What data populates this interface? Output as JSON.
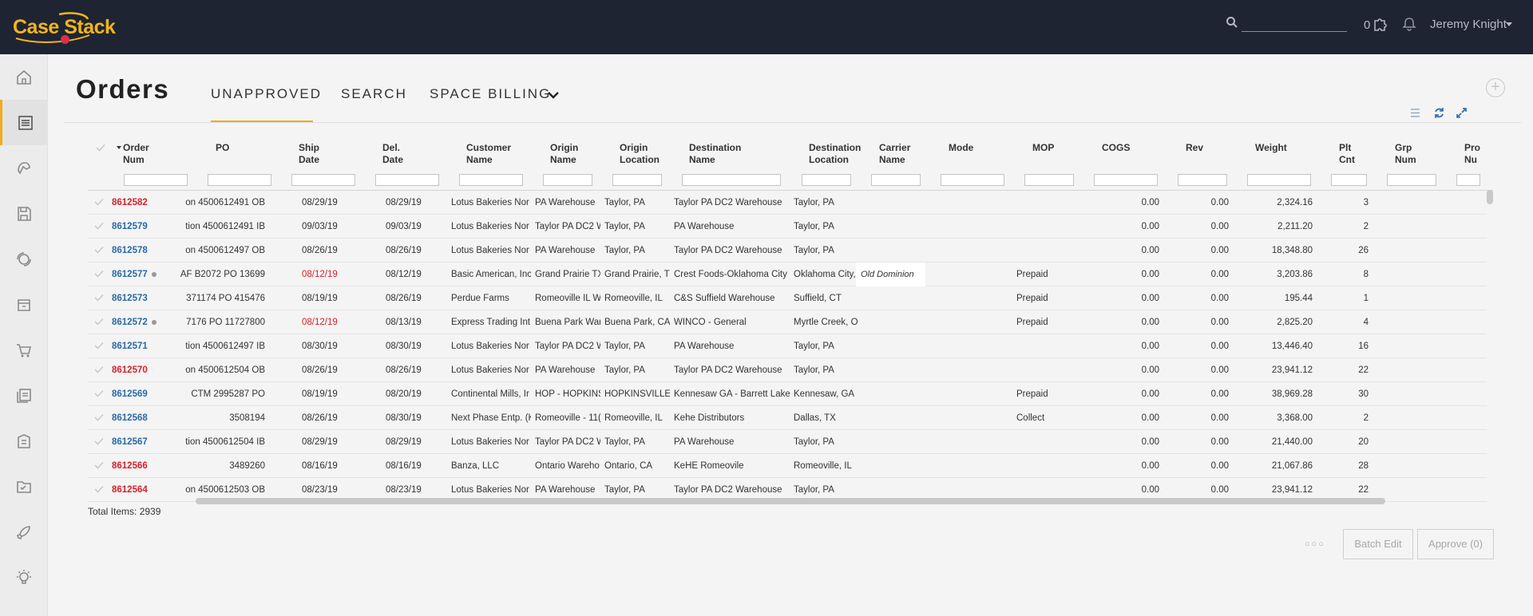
{
  "app": {
    "brand": "Case Stack"
  },
  "topbar": {
    "search_placeholder": "",
    "notification_count": "0",
    "user_name": "Jeremy Knight"
  },
  "sidebar": {
    "items": [
      {
        "icon": "home-icon"
      },
      {
        "icon": "orders-list-icon",
        "active": true
      },
      {
        "icon": "hand-shake-icon"
      },
      {
        "icon": "save-icon"
      },
      {
        "icon": "sync-icon"
      },
      {
        "icon": "box-icon"
      },
      {
        "icon": "cart-icon"
      },
      {
        "icon": "documents-icon"
      },
      {
        "icon": "building-icon"
      },
      {
        "icon": "checklist-folder-icon"
      },
      {
        "icon": "rocket-icon"
      },
      {
        "icon": "lightbulb-icon"
      }
    ]
  },
  "page": {
    "title": "Orders",
    "tabs": [
      "UNAPPROVED",
      "SEARCH",
      "SPACE BILLING"
    ],
    "active_tab": "UNAPPROVED"
  },
  "grid": {
    "columns": [
      {
        "key": "order",
        "label": [
          "Order",
          "Num"
        ]
      },
      {
        "key": "po",
        "label": [
          "PO",
          ""
        ]
      },
      {
        "key": "ship",
        "label": [
          "Ship",
          "Date"
        ]
      },
      {
        "key": "del",
        "label": [
          "Del.",
          "Date"
        ]
      },
      {
        "key": "customer",
        "label": [
          "Customer",
          "Name"
        ]
      },
      {
        "key": "origin_name",
        "label": [
          "Origin",
          "Name"
        ]
      },
      {
        "key": "origin_loc",
        "label": [
          "Origin",
          "Location"
        ]
      },
      {
        "key": "dest_name",
        "label": [
          "Destination",
          "Name"
        ]
      },
      {
        "key": "dest_loc",
        "label": [
          "Destination",
          "Location"
        ]
      },
      {
        "key": "carrier",
        "label": [
          "Carrier",
          "Name"
        ]
      },
      {
        "key": "mode",
        "label": [
          "Mode",
          ""
        ]
      },
      {
        "key": "mop",
        "label": [
          "MOP",
          ""
        ]
      },
      {
        "key": "cogs",
        "label": [
          "COGS",
          ""
        ]
      },
      {
        "key": "rev",
        "label": [
          "Rev",
          ""
        ]
      },
      {
        "key": "weight",
        "label": [
          "Weight",
          ""
        ]
      },
      {
        "key": "plt",
        "label": [
          "Plt",
          "Cnt"
        ]
      },
      {
        "key": "grp",
        "label": [
          "Grp",
          "Num"
        ]
      },
      {
        "key": "pro",
        "label": [
          "Pro",
          "Nu"
        ]
      }
    ],
    "rows": [
      {
        "order": "8612582",
        "order_color": "red",
        "dot": false,
        "po": "on 4500612491 OB",
        "ship": "08/29/19",
        "ship_red": false,
        "del": "08/29/19",
        "customer": "Lotus Bakeries Nor",
        "origin_name": "PA Warehouse",
        "origin_loc": "Taylor, PA",
        "dest_name": "Taylor PA DC2 Warehouse",
        "dest_loc": "Taylor, PA",
        "carrier": "",
        "mode": "",
        "mop": "",
        "cogs": "0.00",
        "rev": "0.00",
        "weight": "2,324.16",
        "plt": "3"
      },
      {
        "order": "8612579",
        "order_color": "blue",
        "dot": false,
        "po": "tion 4500612491 IB",
        "ship": "09/03/19",
        "ship_red": false,
        "del": "09/03/19",
        "customer": "Lotus Bakeries Nor",
        "origin_name": "Taylor PA DC2 W",
        "origin_loc": "Taylor, PA",
        "dest_name": "PA Warehouse",
        "dest_loc": "Taylor, PA",
        "carrier": "",
        "mode": "",
        "mop": "",
        "cogs": "0.00",
        "rev": "0.00",
        "weight": "2,211.20",
        "plt": "2"
      },
      {
        "order": "8612578",
        "order_color": "blue",
        "dot": false,
        "po": "on 4500612497 OB",
        "ship": "08/26/19",
        "ship_red": false,
        "del": "08/26/19",
        "customer": "Lotus Bakeries Nor",
        "origin_name": "PA Warehouse",
        "origin_loc": "Taylor, PA",
        "dest_name": "Taylor PA DC2 Warehouse",
        "dest_loc": "Taylor, PA",
        "carrier": "",
        "mode": "",
        "mop": "",
        "cogs": "0.00",
        "rev": "0.00",
        "weight": "18,348.80",
        "plt": "26"
      },
      {
        "order": "8612577",
        "order_color": "blue",
        "dot": true,
        "po": "AF B2072 PO 13699",
        "ship": "08/12/19",
        "ship_red": true,
        "del": "08/12/19",
        "customer": "Basic American, Inc",
        "origin_name": "Grand Prairie TX",
        "origin_loc": "Grand Prairie, T",
        "dest_name": "Crest Foods-Oklahoma City",
        "dest_loc": "Oklahoma City,",
        "carrier": "Old Dominion",
        "mode": "",
        "mop": "Prepaid",
        "cogs": "0.00",
        "rev": "0.00",
        "weight": "3,203.86",
        "plt": "8"
      },
      {
        "order": "8612573",
        "order_color": "blue",
        "dot": false,
        "po": "371174 PO 415476",
        "ship": "08/19/19",
        "ship_red": false,
        "del": "08/26/19",
        "customer": "Perdue Farms",
        "origin_name": "Romeoville IL W",
        "origin_loc": "Romeoville, IL",
        "dest_name": "C&S Suffield Warehouse",
        "dest_loc": "Suffield, CT",
        "carrier": "",
        "mode": "",
        "mop": "Prepaid",
        "cogs": "0.00",
        "rev": "0.00",
        "weight": "195.44",
        "plt": "1"
      },
      {
        "order": "8612572",
        "order_color": "blue",
        "dot": true,
        "po": "7176 PO 11727800",
        "ship": "08/12/19",
        "ship_red": true,
        "del": "08/13/19",
        "customer": "Express Trading Int",
        "origin_name": "Buena Park War",
        "origin_loc": "Buena Park, CA",
        "dest_name": "WINCO - General",
        "dest_loc": "Myrtle Creek, O",
        "carrier": "",
        "mode": "",
        "mop": "Prepaid",
        "cogs": "0.00",
        "rev": "0.00",
        "weight": "2,825.20",
        "plt": "4"
      },
      {
        "order": "8612571",
        "order_color": "blue",
        "dot": false,
        "po": "tion 4500612497 IB",
        "ship": "08/30/19",
        "ship_red": false,
        "del": "08/30/19",
        "customer": "Lotus Bakeries Nor",
        "origin_name": "Taylor PA DC2 W",
        "origin_loc": "Taylor, PA",
        "dest_name": "PA Warehouse",
        "dest_loc": "Taylor, PA",
        "carrier": "",
        "mode": "",
        "mop": "",
        "cogs": "0.00",
        "rev": "0.00",
        "weight": "13,446.40",
        "plt": "16"
      },
      {
        "order": "8612570",
        "order_color": "red",
        "dot": false,
        "po": "on 4500612504 OB",
        "ship": "08/26/19",
        "ship_red": false,
        "del": "08/26/19",
        "customer": "Lotus Bakeries Nor",
        "origin_name": "PA Warehouse",
        "origin_loc": "Taylor, PA",
        "dest_name": "Taylor PA DC2 Warehouse",
        "dest_loc": "Taylor, PA",
        "carrier": "",
        "mode": "",
        "mop": "",
        "cogs": "0.00",
        "rev": "0.00",
        "weight": "23,941.12",
        "plt": "22"
      },
      {
        "order": "8612569",
        "order_color": "blue",
        "dot": false,
        "po": "CTM 2995287 PO",
        "ship": "08/19/19",
        "ship_red": false,
        "del": "08/20/19",
        "customer": "Continental Mills, Ir",
        "origin_name": "HOP - HOPKINS",
        "origin_loc": "HOPKINSVILLE,",
        "dest_name": "Kennesaw GA - Barrett Lake",
        "dest_loc": "Kennesaw, GA",
        "carrier": "",
        "mode": "",
        "mop": "Prepaid",
        "cogs": "0.00",
        "rev": "0.00",
        "weight": "38,969.28",
        "plt": "30"
      },
      {
        "order": "8612568",
        "order_color": "blue",
        "dot": false,
        "po": "3508194",
        "ship": "08/26/19",
        "ship_red": false,
        "del": "08/30/19",
        "customer": "Next Phase Entp. (K",
        "origin_name": "Romeoville - 11(",
        "origin_loc": "Romeoville, IL",
        "dest_name": "Kehe Distributors",
        "dest_loc": "Dallas, TX",
        "carrier": "",
        "mode": "",
        "mop": "Collect",
        "cogs": "0.00",
        "rev": "0.00",
        "weight": "3,368.00",
        "plt": "2"
      },
      {
        "order": "8612567",
        "order_color": "blue",
        "dot": false,
        "po": "tion 4500612504 IB",
        "ship": "08/29/19",
        "ship_red": false,
        "del": "08/29/19",
        "customer": "Lotus Bakeries Nor",
        "origin_name": "Taylor PA DC2 W",
        "origin_loc": "Taylor, PA",
        "dest_name": "PA Warehouse",
        "dest_loc": "Taylor, PA",
        "carrier": "",
        "mode": "",
        "mop": "",
        "cogs": "0.00",
        "rev": "0.00",
        "weight": "21,440.00",
        "plt": "20"
      },
      {
        "order": "8612566",
        "order_color": "red",
        "dot": false,
        "po": "3489260",
        "ship": "08/16/19",
        "ship_red": false,
        "del": "08/16/19",
        "customer": "Banza, LLC",
        "origin_name": "Ontario Wareho",
        "origin_loc": "Ontario, CA",
        "dest_name": "KeHE Romeovile",
        "dest_loc": "Romeoville, IL",
        "carrier": "",
        "mode": "",
        "mop": "",
        "cogs": "0.00",
        "rev": "0.00",
        "weight": "21,067.86",
        "plt": "28"
      },
      {
        "order": "8612564",
        "order_color": "red",
        "dot": false,
        "po": "on 4500612503 OB",
        "ship": "08/23/19",
        "ship_red": false,
        "del": "08/23/19",
        "customer": "Lotus Bakeries Nor",
        "origin_name": "PA Warehouse",
        "origin_loc": "Taylor, PA",
        "dest_name": "Taylor PA DC2 Warehouse",
        "dest_loc": "Taylor, PA",
        "carrier": "",
        "mode": "",
        "mop": "",
        "cogs": "0.00",
        "rev": "0.00",
        "weight": "23,941.12",
        "plt": "22"
      }
    ],
    "total_label": "Total Items: 2939"
  },
  "footer": {
    "batch_edit_label": "Batch Edit",
    "approve_label": "Approve (0)"
  },
  "colors": {
    "topbar": "#1f2433",
    "accent": "#f2a91c",
    "link_blue": "#2a6aa8",
    "alert_red": "#d8212a"
  }
}
